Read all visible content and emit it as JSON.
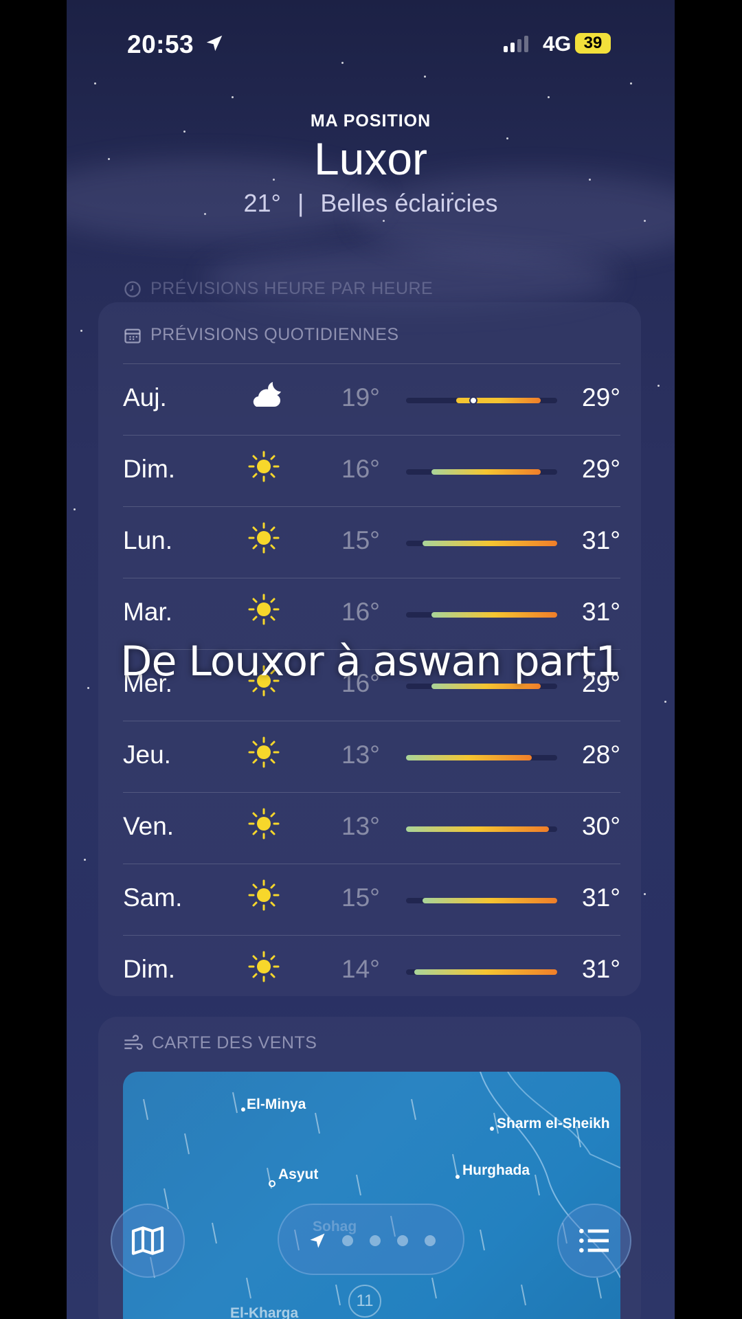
{
  "status_bar": {
    "time": "20:53",
    "network": "4G",
    "battery": "39"
  },
  "header": {
    "location_label": "MA POSITION",
    "city": "Luxor",
    "current_temp": "21°",
    "separator": "|",
    "condition": "Belles éclaircies"
  },
  "sections": {
    "hourly_label": "PRÉVISIONS HEURE PAR HEURE",
    "daily_label": "PRÉVISIONS QUOTIDIENNES",
    "wind_label": "CARTE DES VENTS"
  },
  "forecast": [
    {
      "day": "Auj.",
      "icon": "partly-cloudy-night-icon",
      "low": "19°",
      "high": "29°",
      "low_value": 19,
      "high_value": 29,
      "current_value": 21
    },
    {
      "day": "Dim.",
      "icon": "sun-icon",
      "low": "16°",
      "high": "29°",
      "low_value": 16,
      "high_value": 29
    },
    {
      "day": "Lun.",
      "icon": "sun-icon",
      "low": "15°",
      "high": "31°",
      "low_value": 15,
      "high_value": 31
    },
    {
      "day": "Mar.",
      "icon": "sun-icon",
      "low": "16°",
      "high": "31°",
      "low_value": 16,
      "high_value": 31
    },
    {
      "day": "Mer.",
      "icon": "sun-icon",
      "low": "16°",
      "high": "29°",
      "low_value": 16,
      "high_value": 29
    },
    {
      "day": "Jeu.",
      "icon": "sun-icon",
      "low": "13°",
      "high": "28°",
      "low_value": 13,
      "high_value": 28
    },
    {
      "day": "Ven.",
      "icon": "sun-icon",
      "low": "13°",
      "high": "30°",
      "low_value": 13,
      "high_value": 30
    },
    {
      "day": "Sam.",
      "icon": "sun-icon",
      "low": "15°",
      "high": "31°",
      "low_value": 15,
      "high_value": 31
    },
    {
      "day": "Dim.",
      "icon": "sun-icon",
      "low": "14°",
      "high": "31°",
      "low_value": 14,
      "high_value": 31
    }
  ],
  "overlay_caption": "De Louxor à aswan part1",
  "wind_map": {
    "places": [
      "El-Minya",
      "Sharm el-Sheikh",
      "Asyut",
      "Hurghada",
      "Sohag",
      "El-Kharga"
    ],
    "badge": "11"
  },
  "toolbar": {
    "map_icon": "map-icon",
    "list_icon": "list-icon",
    "location_icon": "location-arrow-icon",
    "page_count": 4
  }
}
